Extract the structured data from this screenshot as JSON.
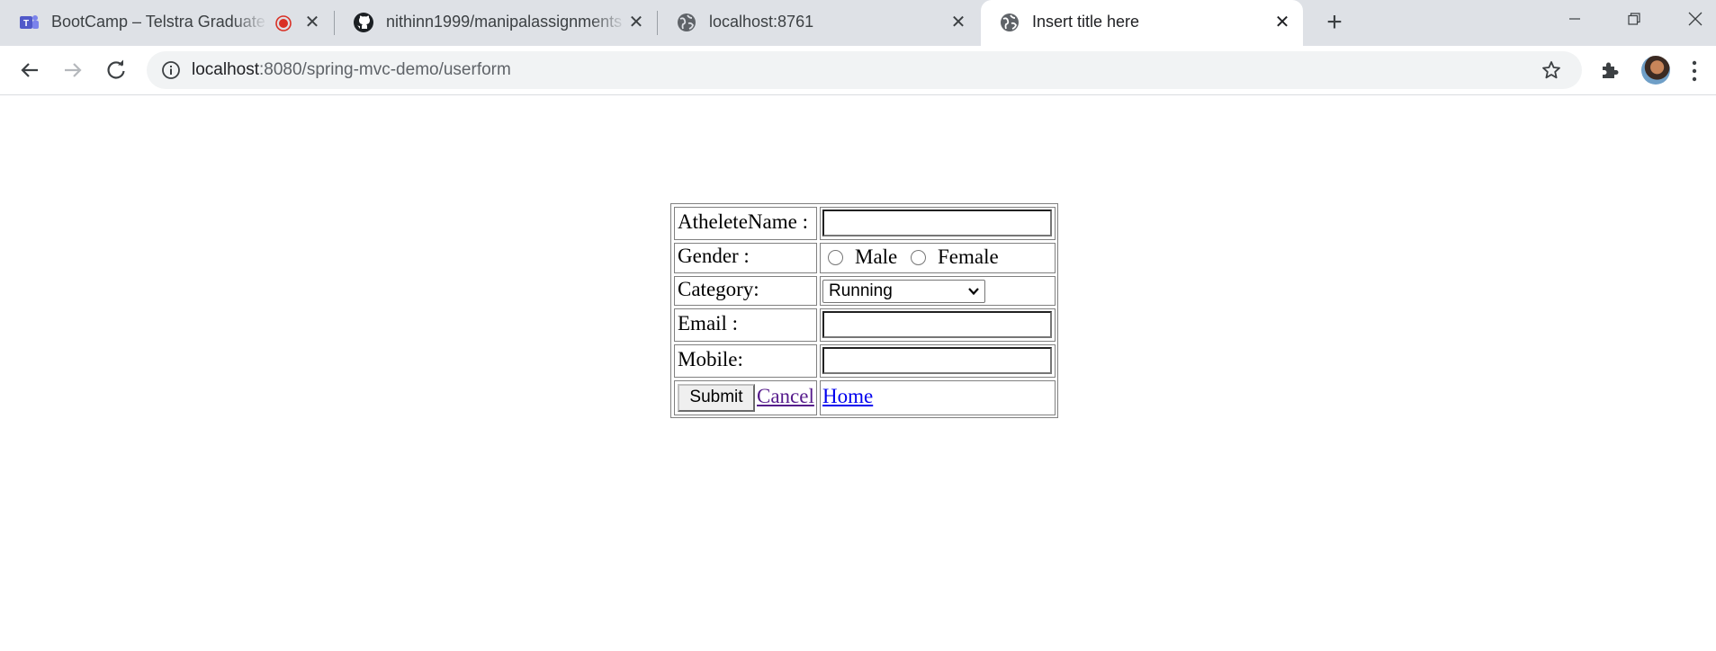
{
  "browser": {
    "tabs": [
      {
        "title": "BootCamp – Telstra Graduate",
        "icon": "teams-icon",
        "recording": true
      },
      {
        "title": "nithinn1999/manipalassignments",
        "icon": "github-icon"
      },
      {
        "title": "localhost:8761",
        "icon": "globe-icon"
      },
      {
        "title": "Insert title here",
        "icon": "globe-icon",
        "active": true
      }
    ],
    "url_host": "localhost",
    "url_rest": ":8080/spring-mvc-demo/userform"
  },
  "form": {
    "athlete_label": "AtheleteName :",
    "athlete_value": "",
    "gender_label": "Gender :",
    "gender_options": [
      "Male",
      "Female"
    ],
    "category_label": "Category:",
    "category_selected": "Running",
    "email_label": "Email :",
    "email_value": "",
    "mobile_label": "Mobile:",
    "mobile_value": "",
    "submit_label": "Submit",
    "cancel_label": "Cancel",
    "home_label": "Home"
  },
  "colors": {
    "visited_link": "#551a8b",
    "link": "#0000ee",
    "tabbar": "#dee1e6",
    "recording": "#d93025"
  }
}
